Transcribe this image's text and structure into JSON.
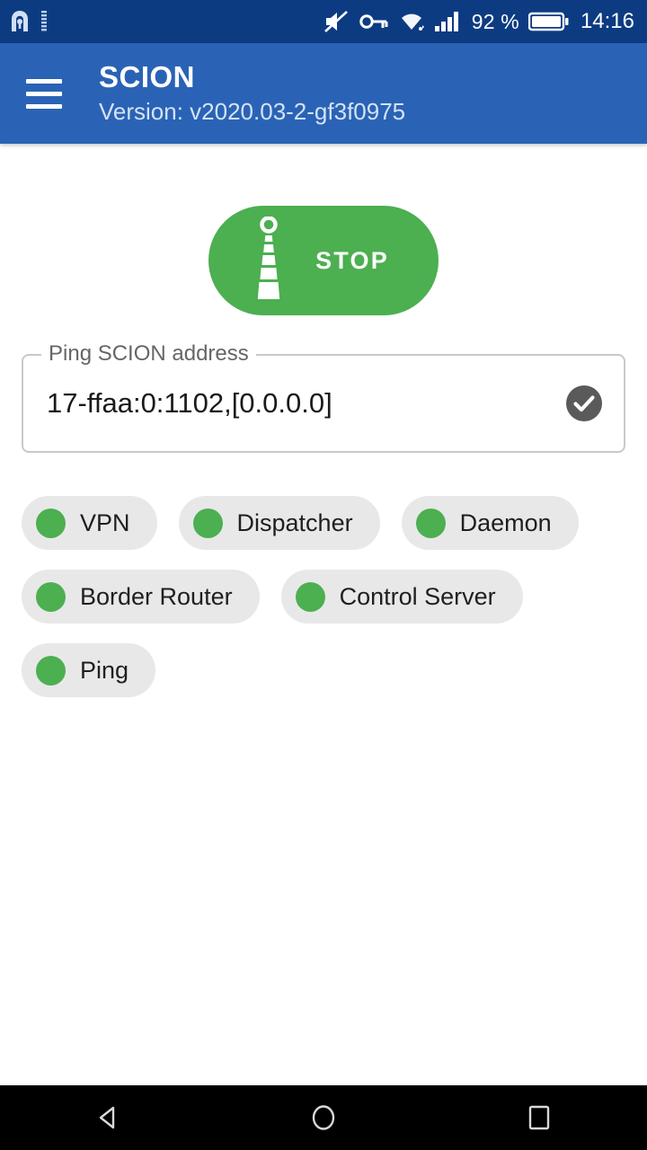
{
  "status_bar": {
    "background": "#0d3b82",
    "left_icons": [
      {
        "name": "app-notification-icon",
        "glyph": "lighthouse-badge"
      },
      {
        "name": "signal-indicator-icon",
        "glyph": "vertical-bars"
      }
    ],
    "right_icons": [
      {
        "name": "volume-muted-icon",
        "glyph": "speaker-muted"
      },
      {
        "name": "vpn-key-icon",
        "glyph": "key"
      },
      {
        "name": "wifi-icon",
        "glyph": "wifi"
      },
      {
        "name": "cellular-signal-icon",
        "glyph": "signal-bars"
      }
    ],
    "battery_percent": "92 %",
    "battery_icon": "battery-icon",
    "clock": "14:16"
  },
  "app_bar": {
    "background": "#2a63b5",
    "menu_icon": "hamburger-menu-icon",
    "title": "SCION",
    "subtitle": "Version: v2020.03-2-gf3f0975"
  },
  "main": {
    "stop_button": {
      "label": "STOP",
      "icon": "scion-beacon-icon",
      "color": "#4caf50",
      "text_color": "#ffffff"
    },
    "ping_field": {
      "label": "Ping SCION address",
      "value": "17-ffaa:0:1102,[0.0.0.0]",
      "placeholder": "Ping SCION address",
      "confirm_icon": "check-circle-icon",
      "confirm_icon_color": "#5a5a5a",
      "border_color": "#c9c9c9"
    },
    "status_chips": [
      {
        "label": "VPN",
        "status_color": "#4caf50",
        "status": "running"
      },
      {
        "label": "Dispatcher",
        "status_color": "#4caf50",
        "status": "running"
      },
      {
        "label": "Daemon",
        "status_color": "#4caf50",
        "status": "running"
      },
      {
        "label": "Border Router",
        "status_color": "#4caf50",
        "status": "running"
      },
      {
        "label": "Control Server",
        "status_color": "#4caf50",
        "status": "running"
      },
      {
        "label": "Ping",
        "status_color": "#4caf50",
        "status": "running"
      }
    ],
    "chip_background": "#e8e8e8"
  },
  "nav_bar": {
    "background": "#000000",
    "buttons": [
      {
        "name": "back-button",
        "icon": "back-triangle-icon"
      },
      {
        "name": "home-button",
        "icon": "home-circle-icon"
      },
      {
        "name": "recents-button",
        "icon": "recents-square-icon"
      }
    ]
  }
}
